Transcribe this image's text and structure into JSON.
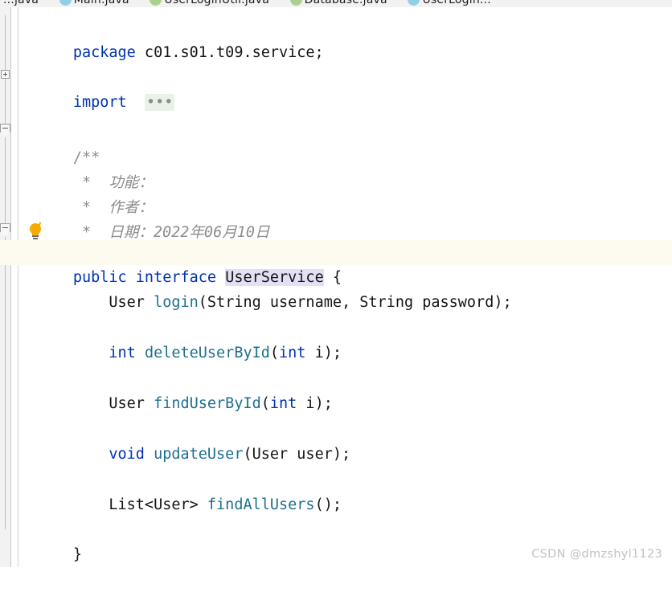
{
  "window": {
    "app": "IntelliJ IDEA",
    "view": "java-editor",
    "file_language": "Java"
  },
  "tabbar": {
    "tabs": [
      {
        "label": "...java",
        "icon": "java-class-icon",
        "dot_color": "#93cee9",
        "active": false
      },
      {
        "label": "Main.java",
        "icon": "java-class-icon",
        "dot_color": "#93cee9",
        "active": false
      },
      {
        "label": "UserLoginUtil.java",
        "icon": "java-interface-icon",
        "dot_color": "#a9d18e",
        "active": false
      },
      {
        "label": "Database.java",
        "icon": "java-interface-icon",
        "dot_color": "#a9d18e",
        "active": false
      },
      {
        "label": "UserLogin...",
        "icon": "java-class-icon",
        "dot_color": "#93cee9",
        "active": false
      }
    ]
  },
  "gutter": {
    "import_fold_state": "collapsed",
    "import_fold_icon": "expand-plus-icon",
    "javadoc_fold_icon": "collapse-minus-icon",
    "class_fold_icon": "collapse-minus-icon",
    "intention_icon": "lightbulb-icon"
  },
  "editor": {
    "font_size_px": 18.5,
    "line_height_px": 31,
    "current_line": "public interface UserService {",
    "highlighted_identifier": "UserService",
    "collapsed_import_placeholder": "...",
    "colors": {
      "keyword": "#0033b3",
      "method": "#1f6f8f",
      "plain_text": "#151515",
      "comment": "#8c8c8c",
      "current_line_bg": "#fdfaf0",
      "identifier_highlight_bg": "#e3e0f5",
      "fold_placeholder_bg": "#e8f2e6",
      "gutter_bg": "#f2f2f2",
      "editor_bg": "#ffffff"
    },
    "code": {
      "package_keyword": "package",
      "package_name": " c01.s01.t09.service;",
      "import_keyword": "import",
      "javadoc_open": "/**",
      "javadoc_line_feature": " *  功能：",
      "javadoc_line_author": " *  作者：",
      "javadoc_line_date": " *  日期：2022年06月10日",
      "decl_public": "public",
      "decl_interface": " interface ",
      "decl_type_name": "UserService",
      "decl_brace": " {",
      "m1_return": "    User ",
      "m1_name": "login",
      "m1_params": "(String username, String password);",
      "m2_return": "    int ",
      "m2_name": "deleteUserById",
      "m2_params_open": "(",
      "m2_params_kw": "int",
      "m2_params_rest": " i);",
      "m3_return": "    User ",
      "m3_name": "findUserById",
      "m3_params_open": "(",
      "m3_params_kw": "int",
      "m3_params_rest": " i);",
      "m4_return": "    void ",
      "m4_name": "updateUser",
      "m4_params": "(User user);",
      "m5_return": "    List<User> ",
      "m5_name": "findAllUsers",
      "m5_params": "();",
      "close_brace": "}"
    }
  },
  "watermark": {
    "text": "CSDN @dmzshyl1123"
  }
}
